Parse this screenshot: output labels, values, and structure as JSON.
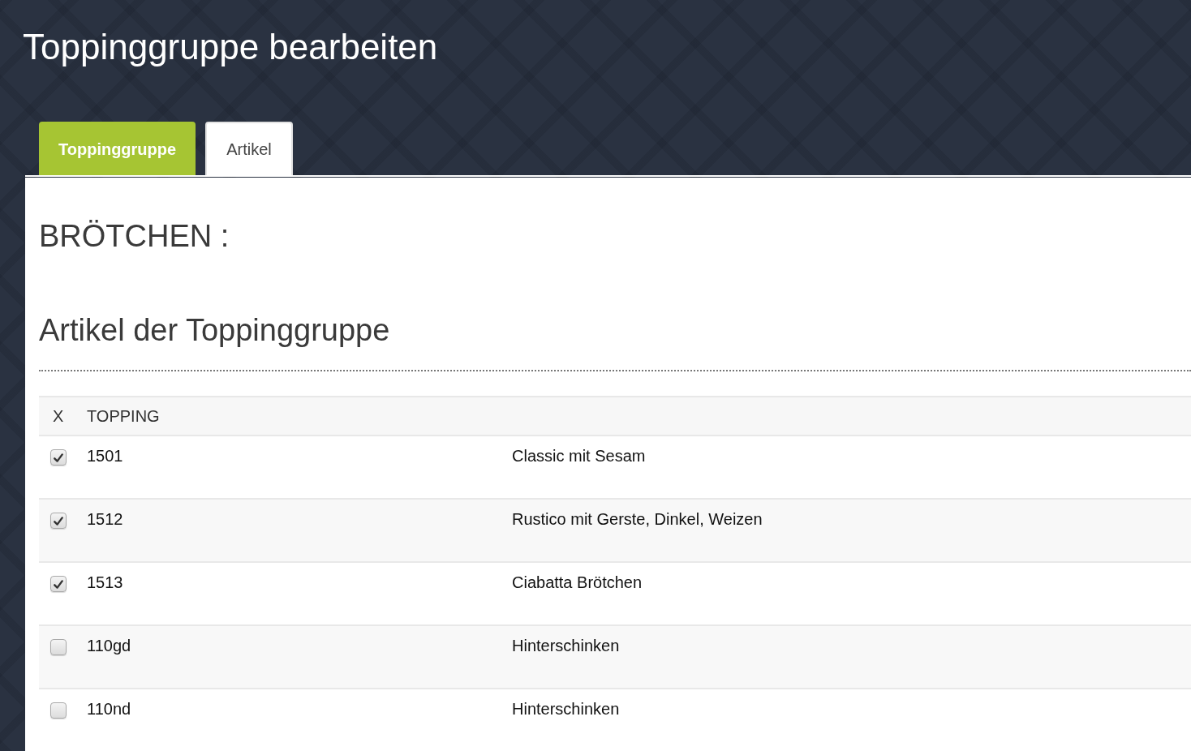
{
  "page": {
    "title": "Toppinggruppe bearbeiten"
  },
  "tabs": [
    {
      "label": "Toppinggruppe",
      "selected": true
    },
    {
      "label": "Artikel",
      "selected": false
    }
  ],
  "group": {
    "heading": "BRÖTCHEN :"
  },
  "section": {
    "title": "Artikel der Toppinggruppe"
  },
  "table": {
    "columns": [
      {
        "label": "X"
      },
      {
        "label": "TOPPING"
      }
    ],
    "rows": [
      {
        "checked": true,
        "topping": "1501",
        "column_3": "Classic mit Sesam"
      },
      {
        "checked": true,
        "topping": "1512",
        "column_3": "Rustico mit Gerste, Dinkel, Weizen"
      },
      {
        "checked": true,
        "topping": "1513",
        "column_3": "Ciabatta Brötchen"
      },
      {
        "checked": false,
        "topping": "110gd",
        "column_3": "Hinterschinken"
      },
      {
        "checked": false,
        "topping": "110nd",
        "column_3": "Hinterschinken"
      }
    ]
  }
}
